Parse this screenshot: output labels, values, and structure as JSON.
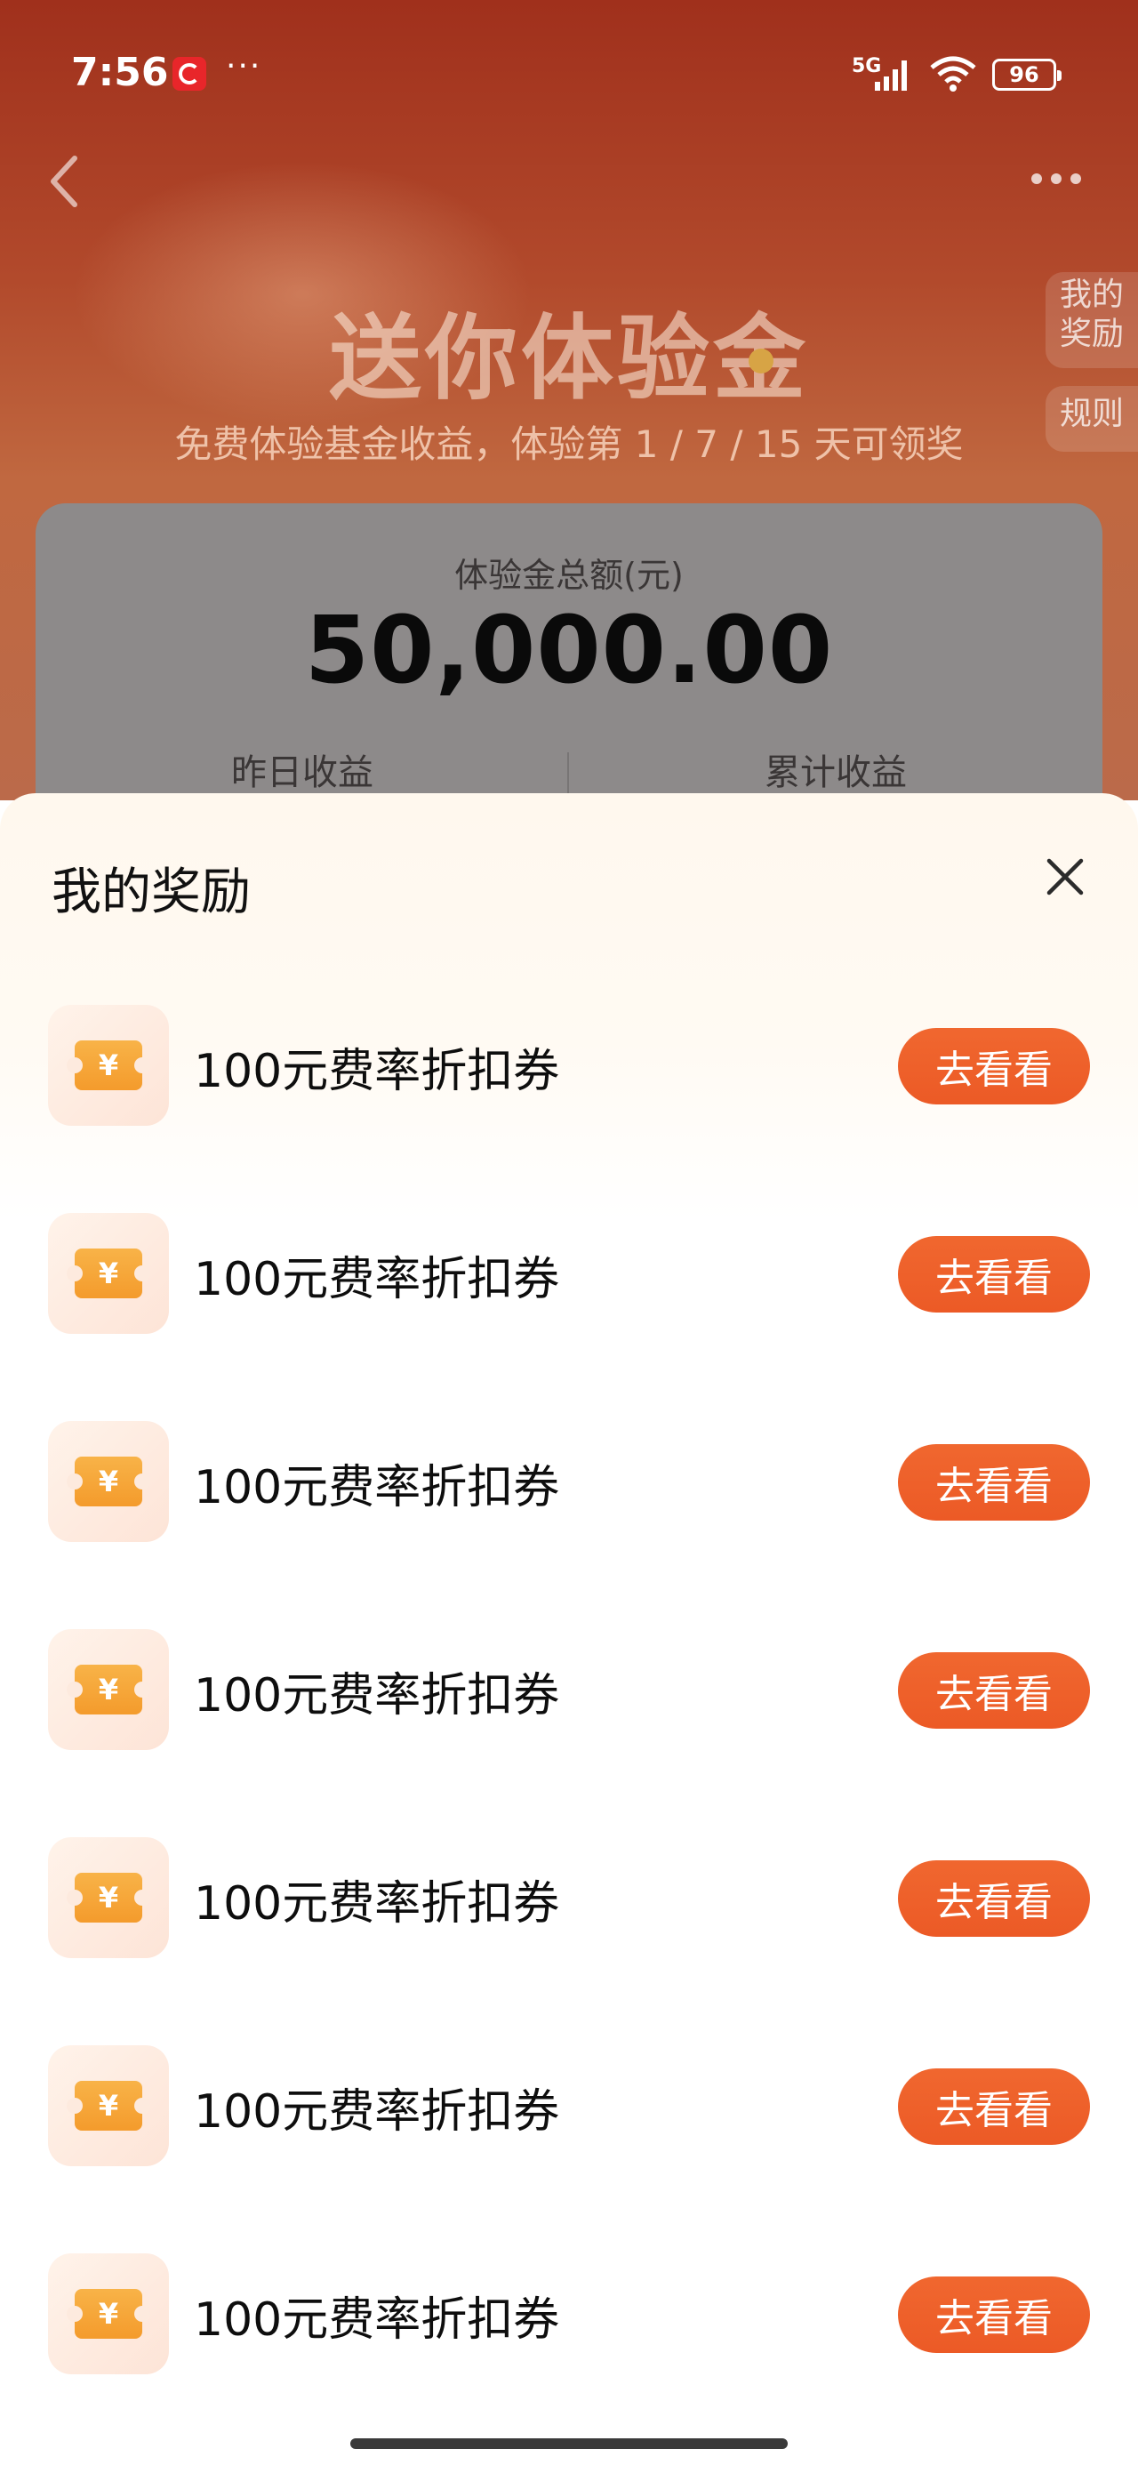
{
  "status_bar": {
    "time": "7:56",
    "more": "···",
    "network": "5G",
    "battery": "96"
  },
  "background": {
    "hero_title": "送你体验金",
    "hero_subtitle": "免费体验基金收益，体验第 1 / 7 / 15 天可领奖",
    "side_my_reward": "我的奖励",
    "side_rules": "规则",
    "card": {
      "label": "体验金总额(元)",
      "amount": "50,000.00",
      "yesterday_label": "昨日收益",
      "total_label": "累计收益"
    }
  },
  "sheet": {
    "title": "我的奖励",
    "rewards": [
      {
        "name": "100元费率折扣券",
        "action": "去看看"
      },
      {
        "name": "100元费率折扣券",
        "action": "去看看"
      },
      {
        "name": "100元费率折扣券",
        "action": "去看看"
      },
      {
        "name": "100元费率折扣券",
        "action": "去看看"
      },
      {
        "name": "100元费率折扣券",
        "action": "去看看"
      },
      {
        "name": "100元费率折扣券",
        "action": "去看看"
      },
      {
        "name": "100元费率折扣券",
        "action": "去看看"
      }
    ],
    "coupon_symbol": "¥"
  },
  "icons": {
    "back": "chevron-left-icon",
    "more": "more-dots-icon",
    "close": "close-icon",
    "coupon": "coupon-ticket-icon"
  },
  "colors": {
    "accent": "#ec5a26",
    "coupon": "#f49b2c"
  }
}
